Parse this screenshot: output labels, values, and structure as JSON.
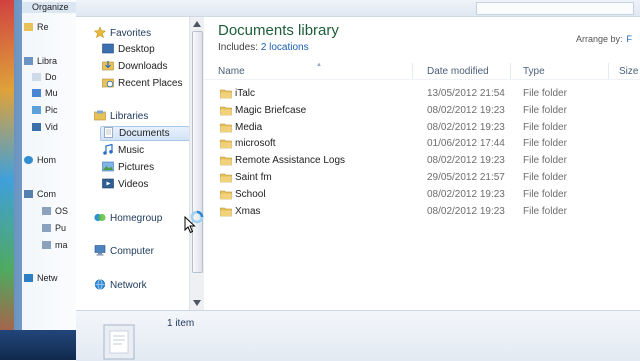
{
  "background_window": {
    "toolbar_label": "Organize",
    "items": [
      {
        "label": "Re",
        "icon": "folder-icon"
      },
      {
        "label": "Libra",
        "icon": "library-icon"
      },
      {
        "label": "Do",
        "icon": "documents-icon"
      },
      {
        "label": "Mu",
        "icon": "music-icon"
      },
      {
        "label": "Pic",
        "icon": "pictures-icon"
      },
      {
        "label": "Vid",
        "icon": "videos-icon"
      },
      {
        "label": "Hom",
        "icon": "homegroup-icon"
      },
      {
        "label": "Com",
        "icon": "computer-icon"
      },
      {
        "label": "OS",
        "icon": "drive-icon"
      },
      {
        "label": "Pu",
        "icon": "drive-icon"
      },
      {
        "label": "ma",
        "icon": "drive-icon"
      },
      {
        "label": "Netw",
        "icon": "network-icon"
      }
    ]
  },
  "nav": {
    "favorites": {
      "label": "Favorites",
      "items": [
        "Desktop",
        "Downloads",
        "Recent Places"
      ]
    },
    "libraries": {
      "label": "Libraries",
      "items": [
        "Documents",
        "Music",
        "Pictures",
        "Videos"
      ],
      "selected": "Documents"
    },
    "homegroup": "Homegroup",
    "computer": "Computer",
    "network": "Network"
  },
  "content": {
    "title": "Documents library",
    "includes_prefix": "Includes:",
    "includes_link": "2 locations",
    "arrange_by_label": "Arrange by:",
    "arrange_by_value": "F",
    "columns": {
      "name": "Name",
      "date_modified": "Date modified",
      "type": "Type",
      "size": "Size"
    },
    "rows": [
      {
        "name": "iTalc",
        "date": "13/05/2012 21:54",
        "type": "File folder"
      },
      {
        "name": "Magic Briefcase",
        "date": "08/02/2012 19:23",
        "type": "File folder"
      },
      {
        "name": "Media",
        "date": "08/02/2012 19:23",
        "type": "File folder"
      },
      {
        "name": "microsoft",
        "date": "01/06/2012 17:44",
        "type": "File folder"
      },
      {
        "name": "Remote Assistance Logs",
        "date": "08/02/2012 19:23",
        "type": "File folder"
      },
      {
        "name": "Saint fm",
        "date": "29/05/2012 21:57",
        "type": "File folder"
      },
      {
        "name": "School",
        "date": "08/02/2012 19:23",
        "type": "File folder"
      },
      {
        "name": "Xmas",
        "date": "08/02/2012 19:23",
        "type": "File folder"
      }
    ]
  },
  "details": {
    "item_count": "1 item"
  },
  "colors": {
    "title_green": "#1e5e3a",
    "link_blue": "#1a5fb4",
    "nav_text": "#1e395b",
    "folder_yellow": "#e8c15a"
  }
}
